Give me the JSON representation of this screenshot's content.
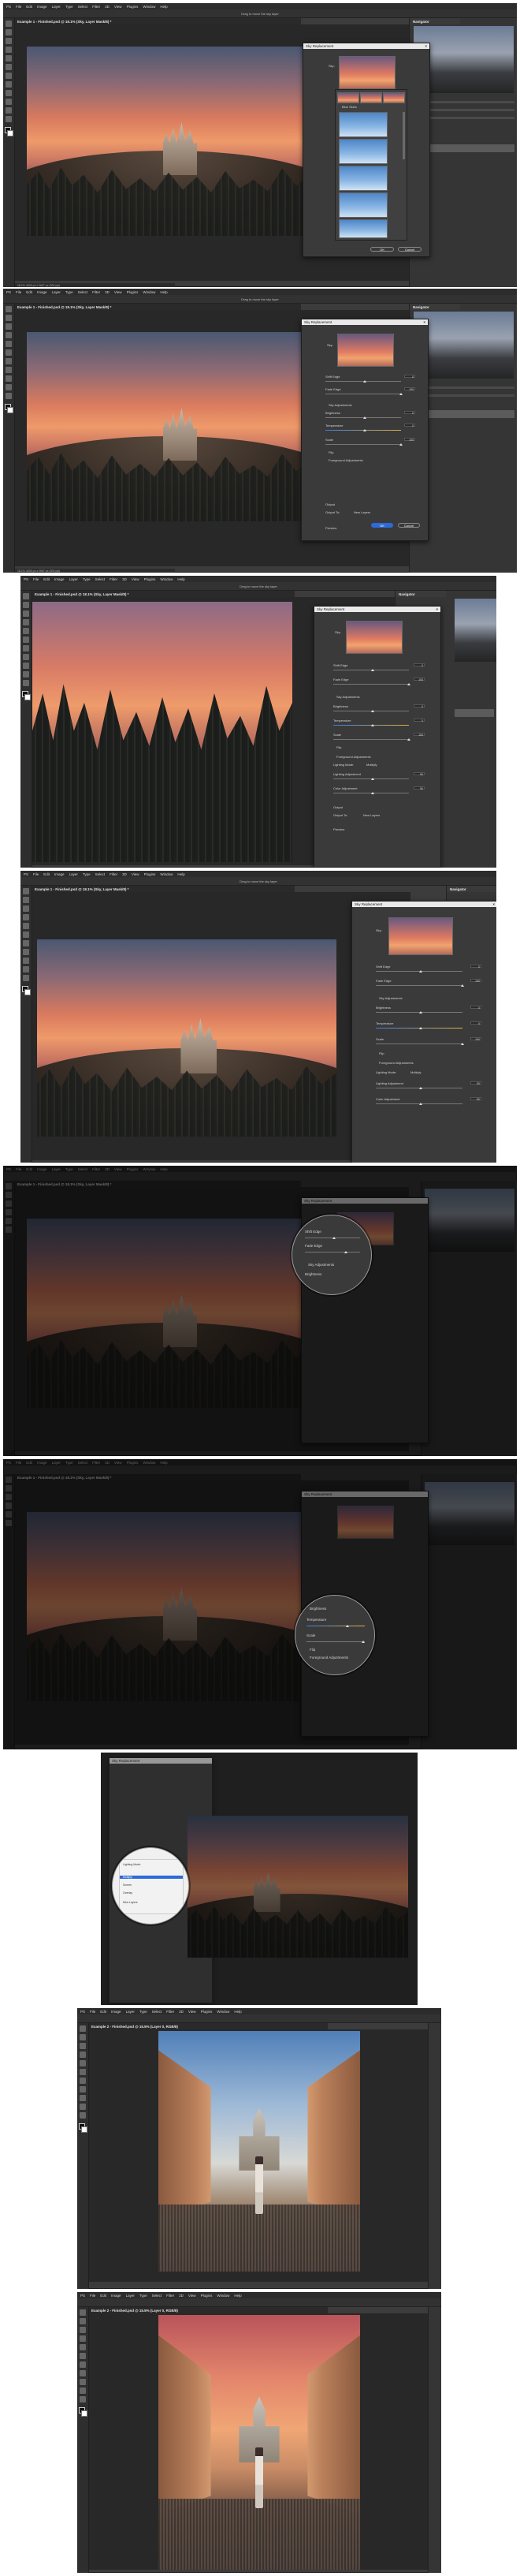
{
  "menu": [
    "PS",
    "File",
    "Edit",
    "Image",
    "Layer",
    "Type",
    "Select",
    "Filter",
    "3D",
    "View",
    "Plugins",
    "Window",
    "Help"
  ],
  "options_hint": "Drag to move the sky layer",
  "doc_tab_castle": "Example 1 - Finished.psd @ 18.1% (Sky, Layer Mask/8) *",
  "doc_tab_castle_b": "Example 1 - Finished.psd @ 18.1% (Sky, Layer Mask/8) *",
  "doc_tab_vatican": "Example 2 - Finished.psd @ 15.5% (Layer 0, RGB/8)",
  "navigator_tab": "Navigator",
  "status_text": "18.1%   4000 px x 2667 px (300 ppi)",
  "dialog": {
    "title": "Sky Replacement",
    "sky_label": "Sky:",
    "shift_edge_label": "Shift Edge",
    "shift_edge_value": "0",
    "fade_edge_label": "Fade Edge",
    "fade_edge_value": "100",
    "sky_adjustments_label": "Sky Adjustments",
    "brightness_label": "Brightness",
    "brightness_value": "0",
    "temperature_label": "Temperature",
    "temperature_value": "0",
    "scale_label": "Scale",
    "scale_value": "100",
    "flip_label": "Flip",
    "foreground_label": "Foreground Adjustments",
    "lighting_mode_label": "Lighting Mode:",
    "lighting_mode_value": "Multiply",
    "lighting_adj_label": "Lighting Adjustment",
    "lighting_adj_value": "50",
    "color_adj_label": "Color Adjustment",
    "color_adj_value": "50",
    "output_label": "Output",
    "output_to_label": "Output To:",
    "output_to_value": "New Layers",
    "preview_label": "Preview",
    "ok_label": "OK",
    "cancel_label": "Cancel",
    "blue_skies_label": "Blue Skies",
    "mode_options": [
      "Multiply",
      "Screen",
      "Overlay"
    ],
    "output_options": [
      "New Layers",
      "Duplicate Layer"
    ]
  },
  "colors": {
    "accent": "#2d6ad8",
    "ui_dark": "#2c2c2c",
    "ui_mid": "#3c3c3c",
    "canvas": "#282828"
  }
}
